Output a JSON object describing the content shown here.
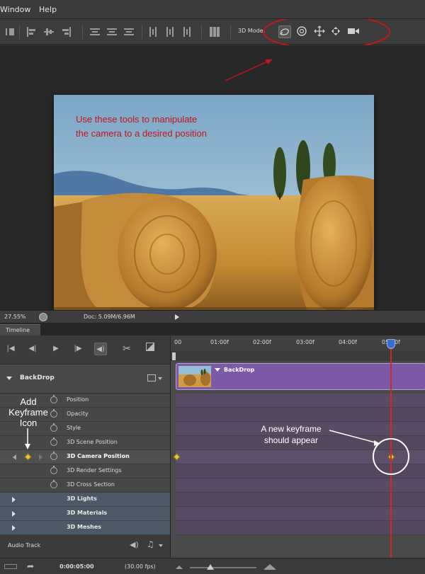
{
  "menu": {
    "items": [
      "Window",
      "Help"
    ]
  },
  "optionsbar": {
    "mode_label": "3D Mode:",
    "mode_icons": [
      "rotate-3d-camera-icon",
      "roll-3d-camera-icon",
      "drag-3d-camera-icon",
      "slide-3d-camera-icon",
      "zoom-3d-camera-icon"
    ]
  },
  "annotations": {
    "tools_note_line1": "Use these tools to manipulate",
    "tools_note_line2": "the camera to a desired position",
    "add_kf_line1": "Add",
    "add_kf_line2": "Keyframe",
    "add_kf_line3": "Icon",
    "new_kf_line1": "A new keyframe",
    "new_kf_line2": "should appear",
    "color": "#c3151c"
  },
  "status": {
    "zoom": "27.55%",
    "doc": "Doc: 5.09M/6.96M"
  },
  "timeline": {
    "tab": "Timeline",
    "ruler": [
      "00",
      "01:00f",
      "02:00f",
      "03:00f",
      "04:00f",
      "05:00f"
    ],
    "layer": {
      "name": "BackDrop",
      "clip_name": "BackDrop",
      "clip_color": "#7c5aa8"
    },
    "properties": [
      "Position",
      "Opacity",
      "Style",
      "3D Scene Position",
      "3D Camera Position",
      "3D Render Settings",
      "3D Cross Section"
    ],
    "groups": [
      "3D Lights",
      "3D Materials",
      "3D Meshes"
    ],
    "audio_label": "Audio Track",
    "current_time": "0:00:05:00",
    "fps": "(30.00 fps)",
    "playhead_color": "#d6262a",
    "keyframe_color": "#e7c83c"
  }
}
